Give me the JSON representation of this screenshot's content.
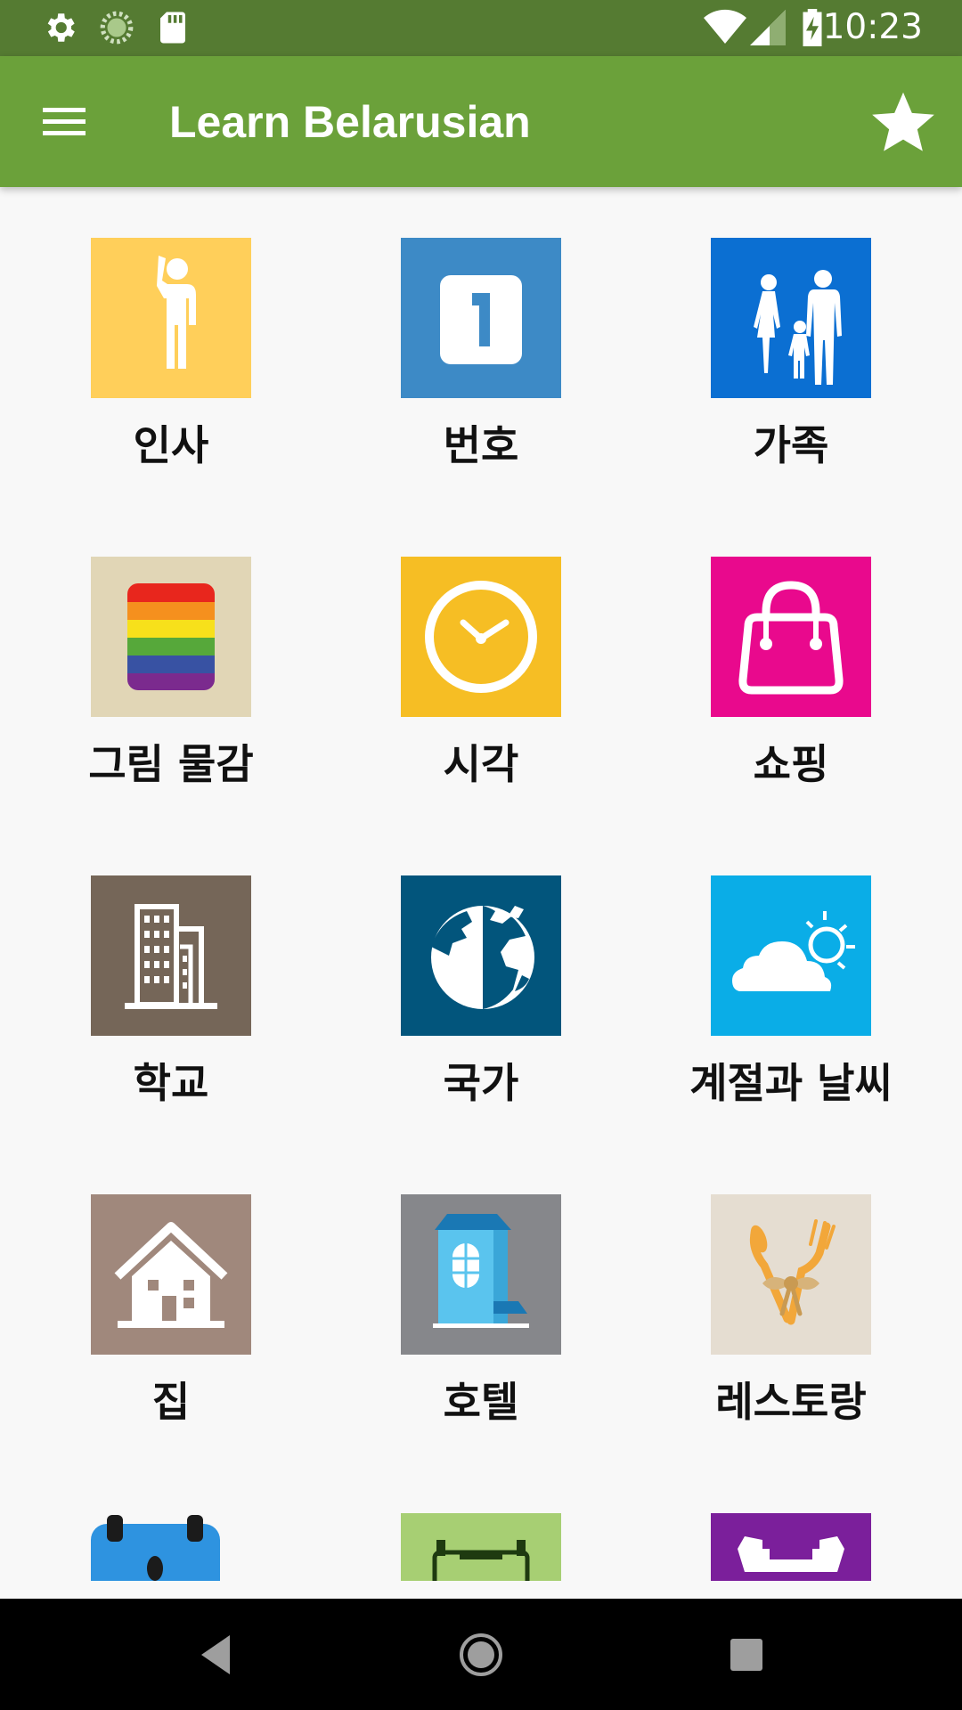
{
  "status_bar": {
    "time": "10:23",
    "icons": [
      "settings-icon",
      "loading-icon",
      "sd-card-icon",
      "wifi-icon",
      "signal-icon",
      "battery-charging-icon"
    ]
  },
  "app_bar": {
    "title": "Learn Belarusian",
    "menu_icon": "hamburger-menu-icon",
    "action_icon": "star-icon"
  },
  "categories": [
    {
      "label": "인사",
      "icon": "greeting-person-icon",
      "color": "#ffcf5a"
    },
    {
      "label": "번호",
      "icon": "number-one-icon",
      "color": "#3d8ac6"
    },
    {
      "label": "가족",
      "icon": "family-icon",
      "color": "#0b6fd2"
    },
    {
      "label": "그림 물감",
      "icon": "color-palette-icon",
      "color": "#e1d6b6"
    },
    {
      "label": "시각",
      "icon": "clock-icon",
      "color": "#f6be24"
    },
    {
      "label": "쇼핑",
      "icon": "shopping-bag-icon",
      "color": "#e9098d"
    },
    {
      "label": "학교",
      "icon": "school-building-icon",
      "color": "#756658"
    },
    {
      "label": "국가",
      "icon": "globe-icon",
      "color": "#02557c"
    },
    {
      "label": "계절과 날씨",
      "icon": "weather-icon",
      "color": "#0aade7"
    },
    {
      "label": "집",
      "icon": "house-icon",
      "color": "#a0887c"
    },
    {
      "label": "호텔",
      "icon": "hotel-icon",
      "color": "#86878b"
    },
    {
      "label": "레스토랑",
      "icon": "restaurant-icon",
      "color": "#e5ddd1"
    },
    {
      "label": "",
      "icon": "calendar-icon",
      "color": "#f8f8f8"
    },
    {
      "label": "",
      "icon": "transport-icon",
      "color": "#a7cf73"
    },
    {
      "label": "",
      "icon": "shopping-cart-icon",
      "color": "#7b1f9b"
    }
  ],
  "nav_bar": {
    "back": "back-icon",
    "home": "home-icon",
    "recents": "recents-icon"
  }
}
